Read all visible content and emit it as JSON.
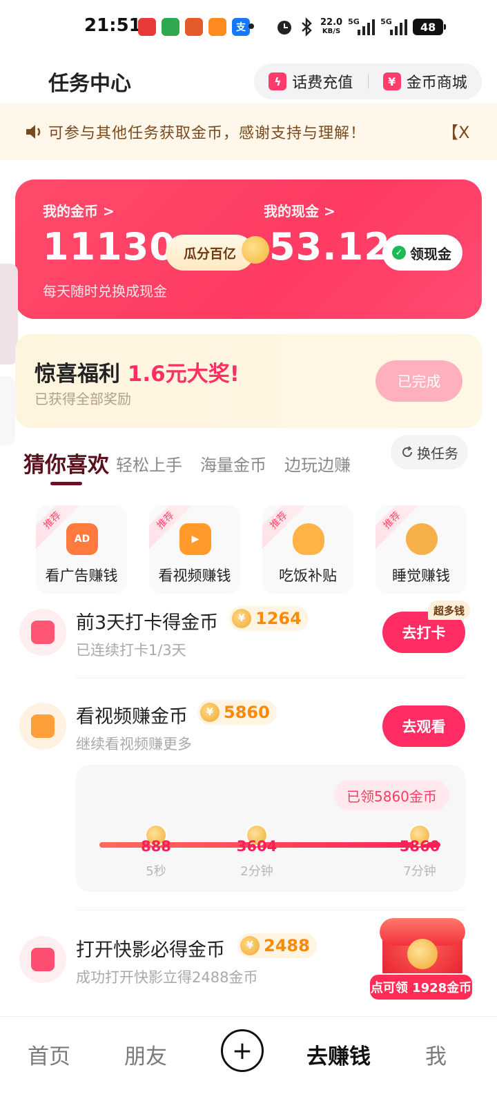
{
  "status_bar": {
    "time": "21:51",
    "network_speed_value": "22.0",
    "network_speed_unit": "KB/S",
    "signal_1_label": "5G",
    "signal_2_label": "5G",
    "battery": "48"
  },
  "header": {
    "title": "任务中心",
    "recharge_label": "话费充值",
    "store_label": "金币商城"
  },
  "notice": {
    "text": "可参与其他任务获取金币，感谢支持与理解！",
    "close_label": "【X"
  },
  "wallet": {
    "coins_label": "我的金币 >",
    "coins_value": "11130",
    "badge_label": "瓜分百亿",
    "cash_label": "我的现金 >",
    "cash_value": "53.12",
    "claim_button": "领现金",
    "subtitle": "每天随时兑换成现金"
  },
  "surprise": {
    "title": "惊喜福利",
    "highlight": "1.6元大奖!",
    "subtitle": "已获得全部奖励",
    "button": "已完成"
  },
  "tabs": {
    "active": "猜你喜欢",
    "tab2": "轻松上手",
    "tab3": "海量金币",
    "tab4": "边玩边赚",
    "refresh": "换任务"
  },
  "quick_cards": [
    {
      "ribbon": "推荐",
      "label": "看广告赚钱",
      "icon_text": "AD",
      "color": "#ff7a3c"
    },
    {
      "ribbon": "推荐",
      "label": "看视频赚钱",
      "icon_text": "▶",
      "color": "#ff9a2b"
    },
    {
      "ribbon": "推荐",
      "label": "吃饭补贴",
      "icon_text": "",
      "color": "#ffb347"
    },
    {
      "ribbon": "推荐",
      "label": "睡觉赚钱",
      "icon_text": "",
      "color": "#f5b04a"
    }
  ],
  "tasks": {
    "checkin": {
      "title": "前3天打卡得金币",
      "coins": "1264",
      "subtitle": "已连续打卡1/3天",
      "button": "去打卡",
      "tag": "超多钱"
    },
    "video": {
      "title": "看视频赚金币",
      "coins": "5860",
      "subtitle": "继续看视频赚更多",
      "button": "去观看"
    },
    "kuaiying": {
      "title": "打开快影必得金币",
      "coins": "2488",
      "subtitle": "成功打开快影立得2488金币"
    }
  },
  "progress": {
    "claimed": "已领5860金币",
    "steps": [
      {
        "value": "888",
        "time": "5秒"
      },
      {
        "value": "3604",
        "time": "2分钟"
      },
      {
        "value": "5860",
        "time": "7分钟"
      }
    ]
  },
  "red_packet": {
    "label": "点可领 1928金币"
  },
  "bottom_nav": {
    "home": "首页",
    "friends": "朋友",
    "plus": "+",
    "earn": "去赚钱",
    "me": "我"
  },
  "colors": {
    "primary": "#ff2d63",
    "wallet_bg": "#ff4168",
    "coin_orange": "#ff8a00",
    "notice_bg": "#fff8ea"
  }
}
